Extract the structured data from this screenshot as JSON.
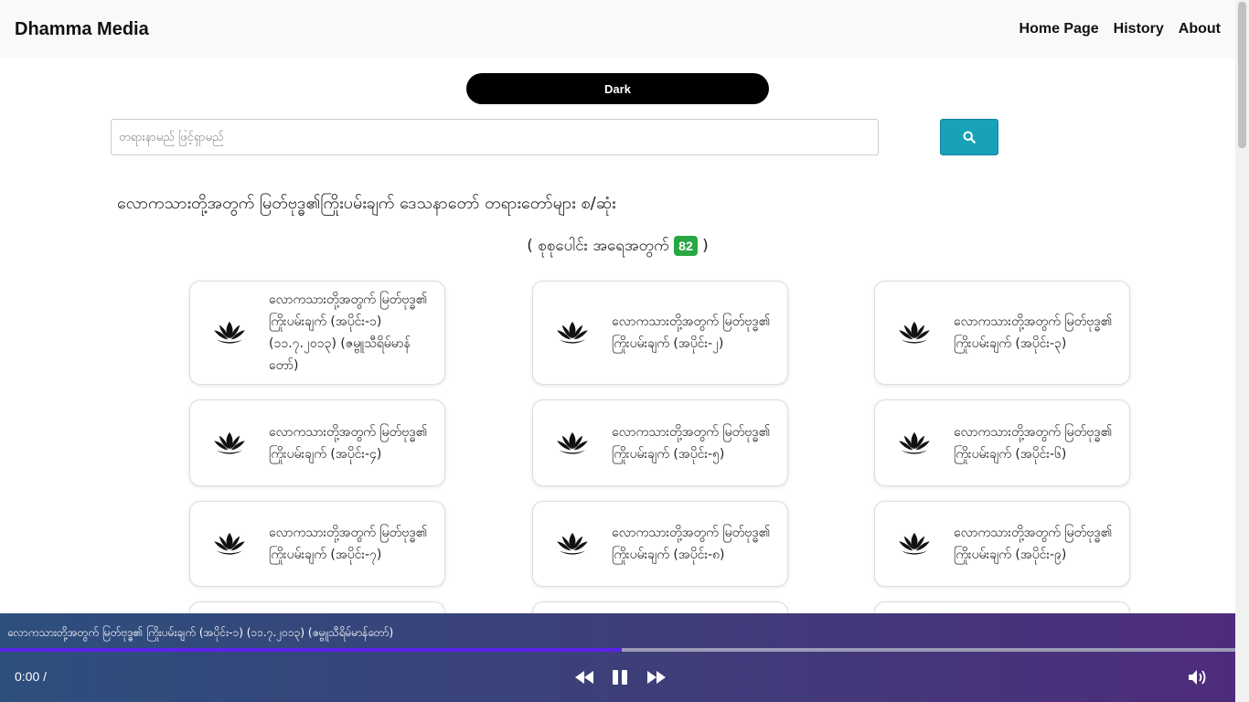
{
  "navbar": {
    "brand": "Dhamma Media",
    "links": [
      "Home Page",
      "History",
      "About"
    ]
  },
  "theme_toggle": {
    "label": "Dark"
  },
  "search": {
    "placeholder": "တရားနာမည် ဖြင့်ရှာမည်",
    "button_icon": "search-icon"
  },
  "heading": "လောကသားတို့အတွက် မြတ်ဗုဒ္ဓ၏ကြိုးပမ်းချက် ဒေသနာတော် တရားတော်များ စ/ဆုံး",
  "count": {
    "prefix": "( စုစုပေါင်း အရေအတွက်",
    "value": "82",
    "suffix": ")",
    "badge_color": "#28a745"
  },
  "cards": [
    {
      "title": "လောကသားတို့အတွက် မြတ်ဗုဒ္ဓ၏ ကြိုးပမ်းချက် (အပိုင်း-၁) (၁၁.၇.၂၀၁၃) (ဇမ္ဗူသီရိမ်မာန်တော်)",
      "icon": "lotus-icon"
    },
    {
      "title": "လောကသားတို့အတွက် မြတ်ဗုဒ္ဓ၏ ကြိုးပမ်းချက် (အပိုင်း-၂)",
      "icon": "lotus-icon"
    },
    {
      "title": "လောကသားတို့အတွက် မြတ်ဗုဒ္ဓ၏ ကြိုးပမ်းချက် (အပိုင်း-၃)",
      "icon": "lotus-icon"
    },
    {
      "title": "လောကသားတို့အတွက် မြတ်ဗုဒ္ဓ၏ ကြိုးပမ်းချက် (အပိုင်း-၄)",
      "icon": "lotus-icon"
    },
    {
      "title": "လောကသားတို့အတွက် မြတ်ဗုဒ္ဓ၏ ကြိုးပမ်းချက် (အပိုင်း-၅)",
      "icon": "lotus-icon"
    },
    {
      "title": "လောကသားတို့အတွက် မြတ်ဗုဒ္ဓ၏ ကြိုးပမ်းချက် (အပိုင်း-၆)",
      "icon": "lotus-icon"
    },
    {
      "title": "လောကသားတို့အတွက် မြတ်ဗုဒ္ဓ၏ ကြိုးပမ်းချက် (အပိုင်း-၇)",
      "icon": "lotus-icon"
    },
    {
      "title": "လောကသားတို့အတွက် မြတ်ဗုဒ္ဓ၏ ကြိုးပမ်းချက် (အပိုင်း-၈)",
      "icon": "lotus-icon"
    },
    {
      "title": "လောကသားတို့အတွက် မြတ်ဗုဒ္ဓ၏ ကြိုးပမ်းချက် (အပိုင်း-၉)",
      "icon": "lotus-icon"
    }
  ],
  "player": {
    "now_playing": "လောကသားတို့အတွက် မြတ်ဗုဒ္ဓ၏ ကြိုးပမ်းချက် (အပိုင်း-၁) (၁၁.၇.၂၀၁၃) (ဇမ္ဗူသီရိမ်မာန်တော်)",
    "time": "0:00 /",
    "progress_fraction": 0.503,
    "controls": [
      "rewind-icon",
      "pause-icon",
      "fast-forward-icon",
      "volume-icon"
    ],
    "colors": {
      "progress_fill": "#5b22e8",
      "gradient_start": "#2d4f7c",
      "gradient_end": "#4e2c7c"
    }
  }
}
